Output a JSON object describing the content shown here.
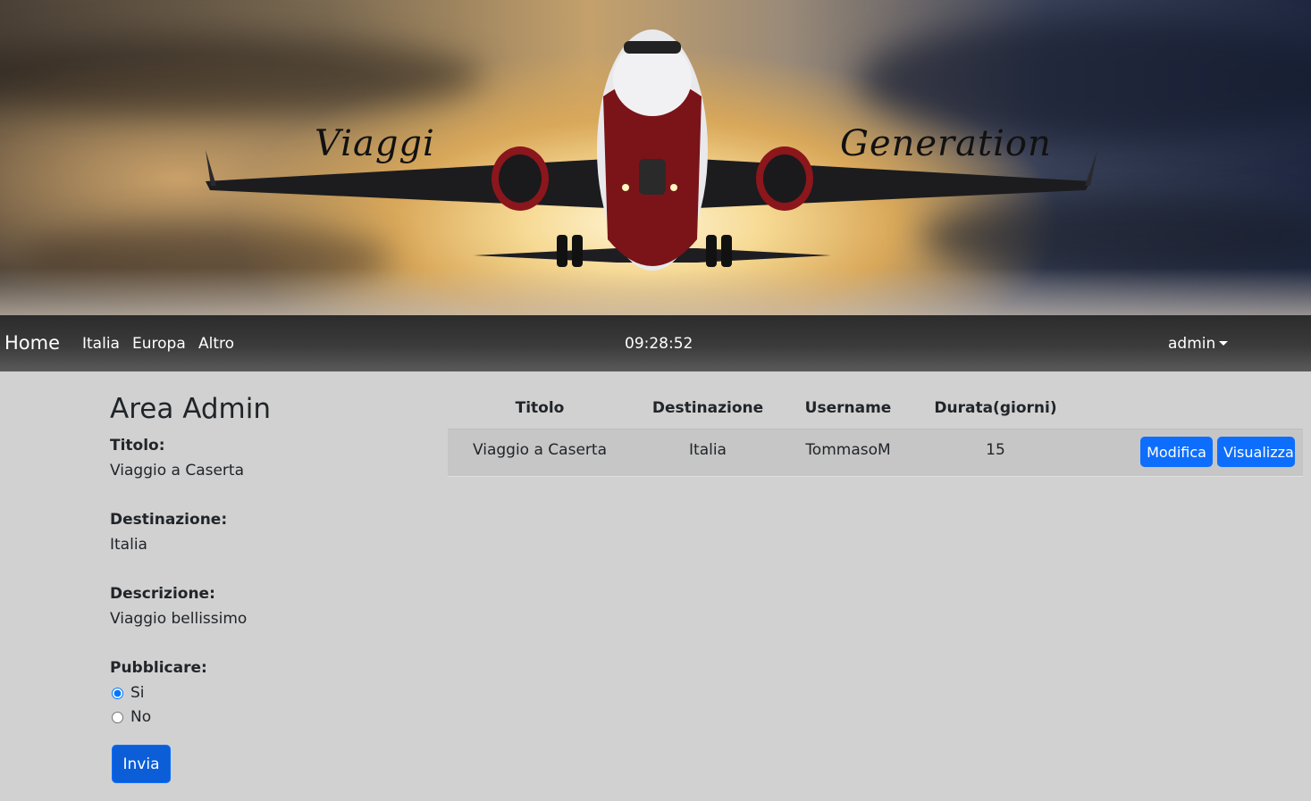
{
  "banner": {
    "title_left": "Viaggi",
    "title_right": "Generation"
  },
  "navbar": {
    "brand": "Home",
    "links": [
      "Italia",
      "Europa",
      "Altro"
    ],
    "clock": "09:28:52",
    "user": "admin"
  },
  "admin": {
    "title": "Area Admin",
    "fields": [
      {
        "label": "Titolo:",
        "value": "Viaggio a Caserta"
      },
      {
        "label": "Destinazione:",
        "value": "Italia"
      },
      {
        "label": "Descrizione:",
        "value": "Viaggio bellissimo"
      }
    ],
    "publish": {
      "label": "Pubblicare:",
      "options": [
        "Si",
        "No"
      ],
      "selected": "Si"
    },
    "submit_label": "Invia"
  },
  "table": {
    "headers": [
      "Titolo",
      "Destinazione",
      "Username",
      "Durata(giorni)"
    ],
    "rows": [
      {
        "titolo": "Viaggio a Caserta",
        "destinazione": "Italia",
        "username": "TommasoM",
        "durata": "15",
        "edit_label": "Modifica",
        "view_label": "Visualizza"
      }
    ]
  },
  "colors": {
    "primary": "#0d6efd",
    "page_bg": "#d1d1d1",
    "navbar_bg": "#333333"
  }
}
